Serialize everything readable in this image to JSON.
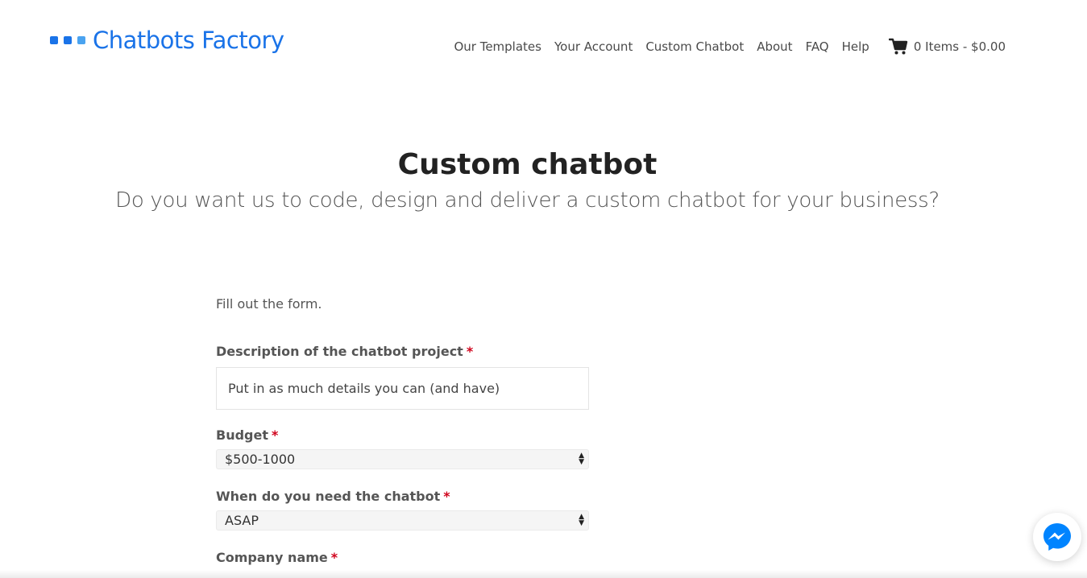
{
  "colors": {
    "brand": "#1a73e8",
    "brand_dots": [
      "#1a73e8",
      "#1a73e8",
      "#4aa3f0"
    ],
    "required": "#d0021b",
    "messenger": "#0084ff"
  },
  "header": {
    "brand_name": "Chatbots Factory",
    "nav": {
      "templates": "Our Templates",
      "account": "Your Account",
      "custom": "Custom Chatbot",
      "about": "About",
      "faq": "FAQ",
      "help": "Help"
    },
    "cart": {
      "icon": "cart-icon",
      "label": "0 Items - $0.00"
    }
  },
  "hero": {
    "title": "Custom chatbot",
    "subtitle": "Do you want us to code, design and deliver a custom chatbot for your business?"
  },
  "form": {
    "intro": "Fill out the form.",
    "required_marker": "*",
    "description": {
      "label": "Description of the chatbot project",
      "placeholder": "Put in as much details you can (and have)"
    },
    "budget": {
      "label": "Budget",
      "selected": "$500-1000"
    },
    "when": {
      "label": "When do you need the chatbot",
      "selected": "ASAP"
    },
    "company": {
      "label": "Company name"
    }
  },
  "messenger": {
    "icon": "messenger-icon"
  }
}
